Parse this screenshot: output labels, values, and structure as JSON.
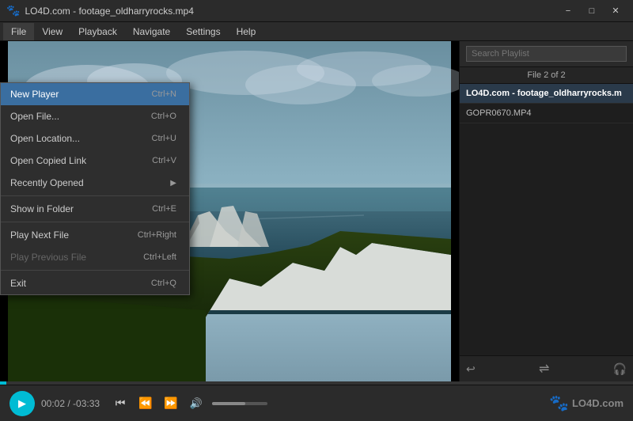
{
  "window": {
    "title": "LO4D.com - footage_oldharryrocks.mp4",
    "logo": "🐾"
  },
  "titlebar": {
    "minimize": "−",
    "maximize": "□",
    "close": "✕"
  },
  "menubar": {
    "items": [
      {
        "id": "file",
        "label": "File",
        "active": true
      },
      {
        "id": "view",
        "label": "View"
      },
      {
        "id": "playback",
        "label": "Playback"
      },
      {
        "id": "navigate",
        "label": "Navigate"
      },
      {
        "id": "settings",
        "label": "Settings"
      },
      {
        "id": "help",
        "label": "Help"
      }
    ]
  },
  "file_menu": {
    "items": [
      {
        "id": "new-player",
        "label": "New Player",
        "shortcut": "Ctrl+N",
        "active": true
      },
      {
        "id": "open-file",
        "label": "Open File...",
        "shortcut": "Ctrl+O"
      },
      {
        "id": "open-location",
        "label": "Open Location...",
        "shortcut": "Ctrl+U"
      },
      {
        "id": "open-copied",
        "label": "Open Copied Link",
        "shortcut": "Ctrl+V"
      },
      {
        "id": "recently-opened",
        "label": "Recently Opened",
        "shortcut": "",
        "arrow": "▶"
      },
      {
        "id": "sep1",
        "type": "separator"
      },
      {
        "id": "show-folder",
        "label": "Show in Folder",
        "shortcut": "Ctrl+E"
      },
      {
        "id": "sep2",
        "type": "separator"
      },
      {
        "id": "play-next",
        "label": "Play Next File",
        "shortcut": "Ctrl+Right"
      },
      {
        "id": "play-prev",
        "label": "Play Previous File",
        "shortcut": "Ctrl+Left",
        "disabled": true
      },
      {
        "id": "sep3",
        "type": "separator"
      },
      {
        "id": "exit",
        "label": "Exit",
        "shortcut": "Ctrl+Q"
      }
    ]
  },
  "playlist": {
    "search_placeholder": "Search Playlist",
    "file_count": "File 2 of 2",
    "items": [
      {
        "id": 1,
        "label": "LO4D.com - footage_oldharryrocks.m",
        "active": true
      },
      {
        "id": 2,
        "label": "GOPR0670.MP4"
      }
    ],
    "footer_buttons": [
      {
        "id": "repeat",
        "icon": "↩",
        "label": "repeat-icon"
      },
      {
        "id": "shuffle",
        "icon": "⇌",
        "label": "shuffle-icon"
      },
      {
        "id": "headphone",
        "icon": "🎧",
        "label": "headphone-icon"
      }
    ]
  },
  "controls": {
    "time_current": "00:02",
    "time_total": "-03:33",
    "progress_percent": 1,
    "volume_percent": 60,
    "buttons": {
      "play": "▶",
      "prev": "⏮",
      "rewind": "⏪",
      "forward": "⏩",
      "volume": "🔊"
    }
  },
  "logo": {
    "icon": "🐾",
    "text": "LO4D.com"
  }
}
